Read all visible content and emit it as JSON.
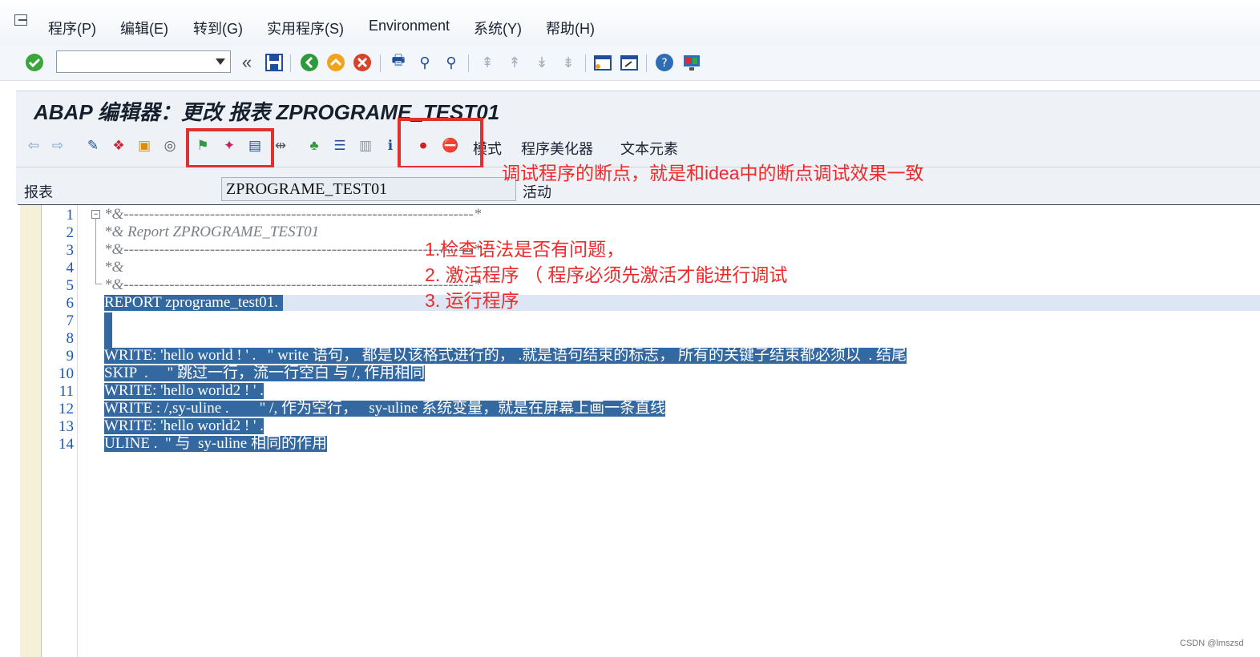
{
  "menu": {
    "items": [
      "程序(P)",
      "编辑(E)",
      "转到(G)",
      "实用程序(S)",
      "Environment",
      "系统(Y)",
      "帮助(H)"
    ]
  },
  "toolbar": {
    "icons": [
      "enter-icon",
      "command-field",
      "back-double-icon",
      "save-icon",
      "back-icon",
      "exit-icon",
      "cancel-icon",
      "print-icon",
      "find-icon",
      "find-next-icon",
      "first-page-icon",
      "prev-page-icon",
      "next-page-icon",
      "last-page-icon",
      "new-session-icon",
      "shortcut-icon",
      "help-icon",
      "customize-layout-icon"
    ]
  },
  "window": {
    "title": "ABAP 编辑器：更改 报表 ZPROGRAME_TEST01"
  },
  "app_toolbar": {
    "buttons": [
      "back-icon",
      "forward-icon",
      "display-change-icon",
      "other-object-icon",
      "active-inactive-icon",
      "where-used-icon",
      "check-icon",
      "activate-icon",
      "test-run-icon",
      "navigate-icon",
      "object-list-icon",
      "enhance-icon",
      "display-object-list-icon",
      "info-icon",
      "set-breakpoint-icon",
      "stop-breakpoint-icon"
    ],
    "pattern_label": "模式",
    "pretty_printer_label": "程序美化器",
    "text_elements_label": "文本元素"
  },
  "annotations": {
    "breakpoint_note": "调试程序的断点，就是和idea中的断点调试效果一致",
    "step1": "1.检查语法是否有问题，",
    "step2": "2. 激活程序 （ 程序必须先激活才能进行调试",
    "step3": "3. 运行程序"
  },
  "report_field": {
    "label": "报表",
    "value": "ZPROGRAME_TEST01",
    "status": "活动"
  },
  "editor": {
    "line_numbers": [
      "1",
      "2",
      "3",
      "4",
      "5",
      "6",
      "7",
      "8",
      "9",
      "10",
      "11",
      "12",
      "13",
      "14"
    ],
    "lines": [
      "*&---------------------------------------------------------------------*",
      "*& Report ZPROGRAME_TEST01",
      "*&---------------------------------------------------------------------*",
      "*&",
      "*&---------------------------------------------------------------------*",
      "REPORT zprograme_test01.",
      "",
      "",
      "WRITE: 'hello world ! ' .   \" write 语句， 都是以该格式进行的， .就是语句结束的标志， 所有的关键子结束都必须以  . 结尾",
      "SKIP  .     \" 跳过一行，流一行空白 与 /, 作用相同",
      "WRITE: 'hello world2 ! ' .",
      "WRITE : /,sy-uline .        \" /, 作为空行，   sy-uline 系统变量，就是在屏幕上画一条直线",
      "WRITE: 'hello world2 ! ' .",
      "ULINE .  \" 与  sy-uline 相同的作用"
    ]
  },
  "watermark": "CSDN @lmszsd",
  "colors": {
    "selection": "#3468a0",
    "annotation": "#ef2a2a",
    "line_numbers": "#1b58b0"
  }
}
